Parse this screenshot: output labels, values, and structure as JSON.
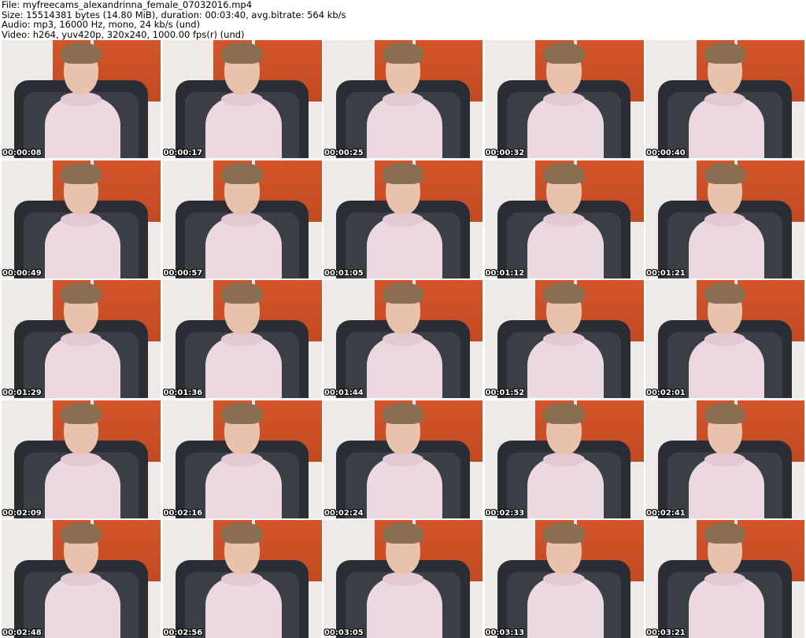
{
  "header": {
    "file": "File: myfreecams_alexandrinna_female_07032016.mp4",
    "size": "Size: 15514381 bytes (14.80 MiB), duration: 00:03:40, avg.bitrate: 564 kb/s",
    "audio": "Audio: mp3, 16000 Hz, mono, 24 kb/s (und)",
    "video": "Video: h264, yuv420p, 320x240, 1000.00 fps(r) (und)"
  },
  "thumbnails": [
    {
      "timestamp": "00:00:08"
    },
    {
      "timestamp": "00:00:17"
    },
    {
      "timestamp": "00:00:25"
    },
    {
      "timestamp": "00:00:32"
    },
    {
      "timestamp": "00:00:40"
    },
    {
      "timestamp": "00:00:49"
    },
    {
      "timestamp": "00:00:57"
    },
    {
      "timestamp": "00:01:05"
    },
    {
      "timestamp": "00:01:12"
    },
    {
      "timestamp": "00:01:21"
    },
    {
      "timestamp": "00:01:29"
    },
    {
      "timestamp": "00:01:36"
    },
    {
      "timestamp": "00:01:44"
    },
    {
      "timestamp": "00:01:52"
    },
    {
      "timestamp": "00:02:01"
    },
    {
      "timestamp": "00:02:09"
    },
    {
      "timestamp": "00:02:16"
    },
    {
      "timestamp": "00:02:24"
    },
    {
      "timestamp": "00:02:33"
    },
    {
      "timestamp": "00:02:41"
    },
    {
      "timestamp": "00:02:48"
    },
    {
      "timestamp": "00:02:56"
    },
    {
      "timestamp": "00:03:05"
    },
    {
      "timestamp": "00:03:13"
    },
    {
      "timestamp": "00:03:21"
    }
  ],
  "colors": {
    "background": "#ffffff",
    "wall": "#eeeae8",
    "wall_panel": "#d4552a",
    "chair": "#2a2d33",
    "hoodie": "#ecd8e0",
    "timestamp_text": "#ffffff"
  }
}
